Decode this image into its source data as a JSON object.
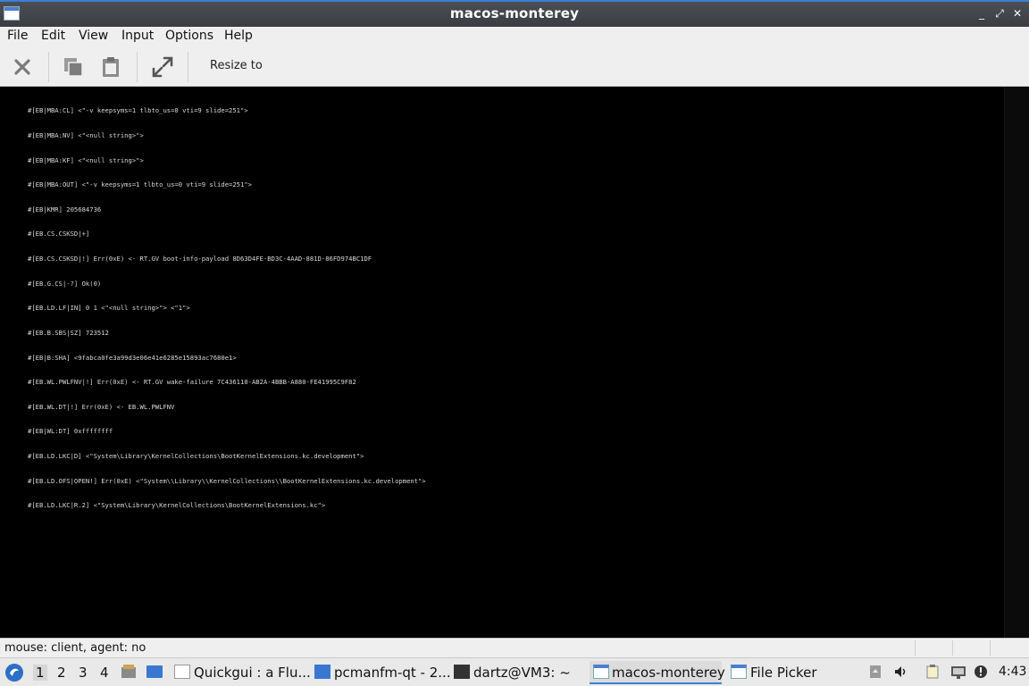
{
  "window": {
    "title": "macos-monterey",
    "controls": [
      "_",
      "⤢",
      "✕"
    ]
  },
  "menu": [
    "File",
    "Edit",
    "View",
    "Input",
    "Options",
    "Help"
  ],
  "toolbar": {
    "resize_label": "Resize to"
  },
  "console": {
    "lines": [
      "#[EB|MBA:CL] <\"-v keepsyms=1 tlbto_us=0 vti=9 slide=251\">",
      "#[EB|MBA:NV] <\"<null string>\">",
      "#[EB|MBA:KF] <\"<null string>\">",
      "#[EB|MBA:OUT] <\"-v keepsyms=1 tlbto_us=0 vti=9 slide=251\">",
      "#[EB|KMR] 205684736",
      "#[EB.CS.CSKSD|+]",
      "#[EB.CS.CSKSD|!] Err(0xE) <- RT.GV boot-info-payload 8D63D4FE-BD3C-4AAD-881D-86FD974BC1DF",
      "#[EB.G.CS|-?] Ok(0)",
      "#[EB.LD.LF|IN] 0 1 <\"<null string>\"> <\"1\">",
      "#[EB.B.SBS|SZ] 723512",
      "#[EB|B:SHA] <9fabca0fe3a99d3e06e41e6285e15893ac7680e1>",
      "#[EB.WL.PWLFNV|!] Err(0xE) <- RT.GV wake-failure 7C436110-AB2A-4BBB-A880-FE41995C9F82",
      "#[EB.WL.DT|!] Err(0xE) <- EB.WL.PWLFNV",
      "#[EB|WL:DT] 0xffffffff",
      "#[EB.LD.LKC|D] <\"System\\Library\\KernelCollections\\BootKernelExtensions.kc.development\">",
      "#[EB.LD.OFS|OPEN!] Err(0xE) <\"System\\\\Library\\\\KernelCollections\\\\BootKernelExtensions.kc.development\">",
      "#[EB.LD.LKC|R.2] <\"System\\Library\\KernelCollections\\BootKernelExtensions.kc\">"
    ]
  },
  "status": {
    "text": "mouse: client, agent:  no"
  },
  "taskbar": {
    "workspaces": [
      "1",
      "2",
      "3",
      "4"
    ],
    "tasks": [
      {
        "label": "Quickgui : a Flu..."
      },
      {
        "label": "pcmanfm-qt - 2..."
      },
      {
        "label": "dartz@VM3: ~"
      },
      {
        "label": "macos-monterey"
      },
      {
        "label": "File Picker"
      }
    ],
    "clock": "4:43"
  },
  "colors": {
    "accent": "#3b7fd6",
    "console_bg": "#000000",
    "console_text": "#d8d8d8"
  }
}
